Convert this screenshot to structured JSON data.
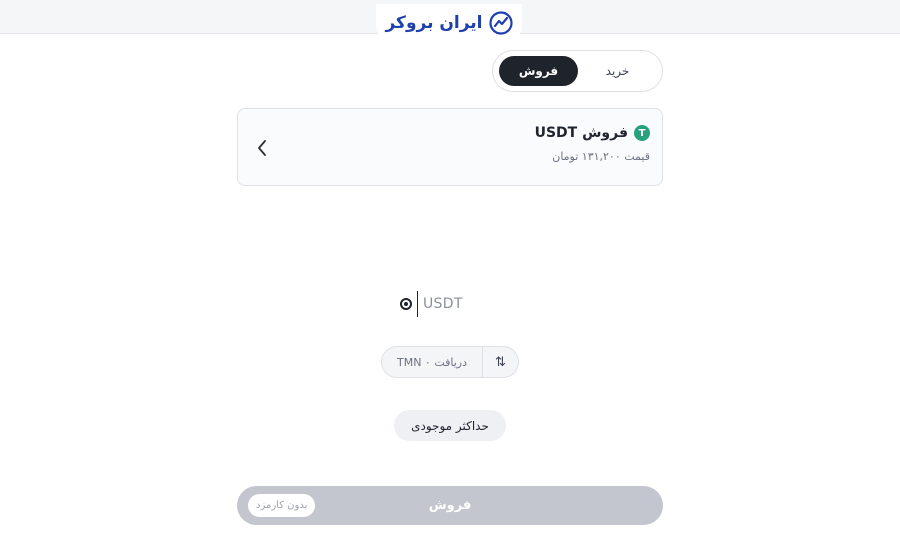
{
  "header": {
    "logo_text": "ایران بروکر"
  },
  "trade_tabs": {
    "buy": "خرید",
    "sell": "فروش",
    "active": "sell"
  },
  "asset": {
    "title": "فروش USDT",
    "price": "قیمت ۱۳۱,۲۰۰ تومان",
    "icon": "tether-icon",
    "icon_glyph": "T"
  },
  "amount": {
    "value": "",
    "unit": "USDT",
    "zero_icon": "zero-circle-icon"
  },
  "receive": {
    "text": "دریافت TMN ۰",
    "swap_glyph": "⇅"
  },
  "max_button": {
    "label": "حداکثر موجودی"
  },
  "submit": {
    "label": "فروش",
    "fee_badge": "بدون کارمزد"
  },
  "colors": {
    "brand": "#1e3fae",
    "active_tab": "#1f232c",
    "submit_disabled": "#c3c6ce",
    "tether": "#26a17b"
  }
}
